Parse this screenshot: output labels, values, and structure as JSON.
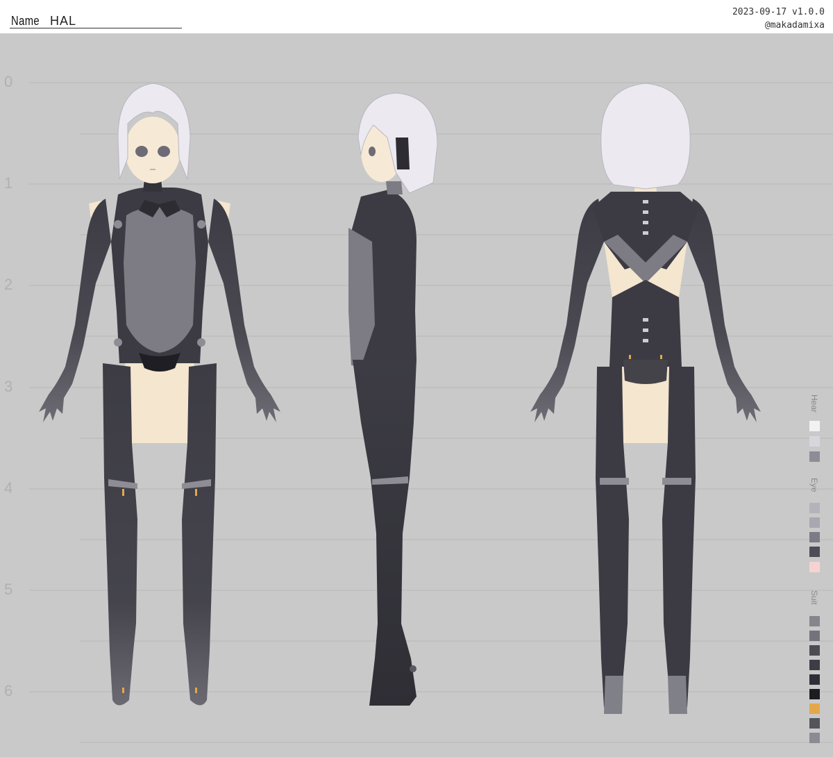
{
  "header": {
    "name_label": "Name",
    "name_value": "HAL",
    "version": "2023-09-17 v1.0.0",
    "author": "@makadamixa"
  },
  "ruler": {
    "labels": [
      "0",
      "1",
      "2",
      "3",
      "4",
      "5",
      "6"
    ]
  },
  "palette": {
    "hair": {
      "label": "Hear",
      "colors": [
        "#f2f1f4",
        "#d8d6dc",
        "#908c96"
      ]
    },
    "eye": {
      "label": "Eye",
      "colors": [
        "#b4b2ba",
        "#a9a7b0",
        "#7e7b86",
        "#4f4c58",
        "#f6d3d2"
      ]
    },
    "suit": {
      "label": "Suit",
      "colors": [
        "#87858c",
        "#74727a",
        "#4d4c53",
        "#3e3d45",
        "#2f2e36",
        "#1d1c22",
        "#e4a84a",
        "#55545a",
        "#8c8a92"
      ]
    }
  },
  "colors": {
    "background": "#c9c9c9",
    "guide_line": "#b4b4b4",
    "suit_dark": "#3a3940",
    "suit_mid": "#4a4951",
    "suit_panel": "#7d7b83",
    "skin": "#f4e6cf",
    "hair": "#eceaf0",
    "accent": "#e4a84a"
  }
}
